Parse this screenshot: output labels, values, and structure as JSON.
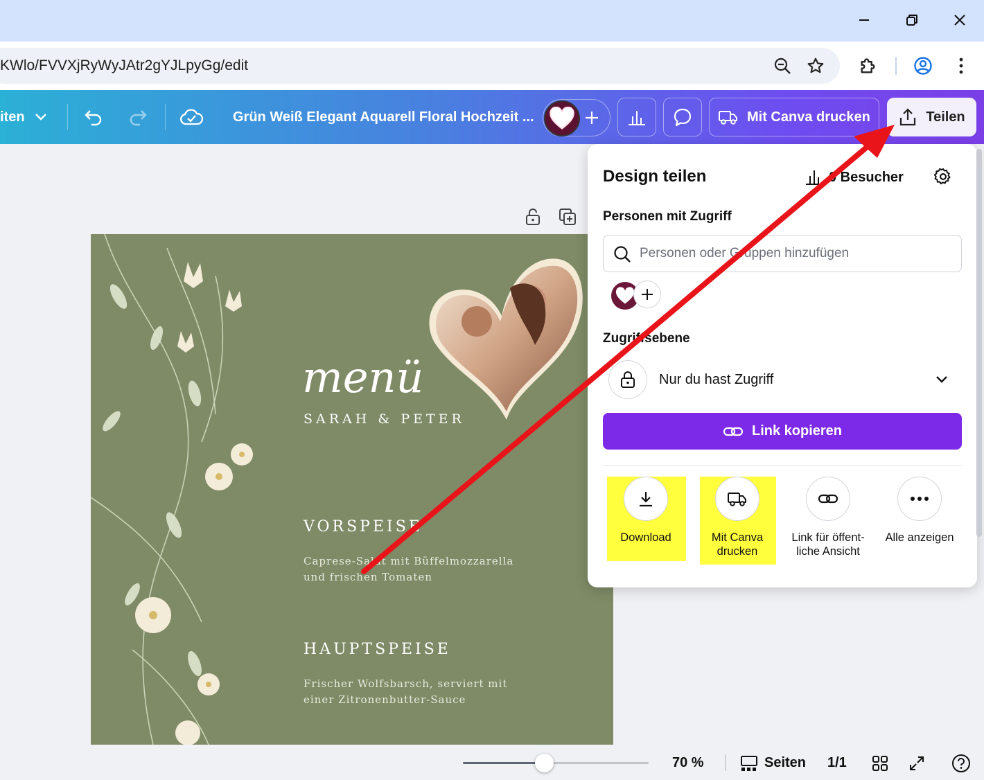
{
  "browser": {
    "url": "KWlo/FVVXjRyWyJAtr2gYJLpyGg/edit",
    "controls": {
      "minimize_icon": "minimize-icon",
      "restore_icon": "restore-icon",
      "close_icon": "close-icon"
    }
  },
  "toolbar": {
    "pages_menu_label": "iten",
    "doc_title": "Grün Weiß Elegant Aquarell Floral Hochzeit ...",
    "print_label": "Mit Canva drucken",
    "share_label": "Teilen"
  },
  "design": {
    "menu_title": "menü",
    "names": "SARAH & PETER",
    "sections": [
      {
        "heading": "VORSPEISE",
        "body_line1": "Caprese-Salat mit Büffelmozzarella",
        "body_line2": "und frischen Tomaten"
      },
      {
        "heading": "HAUPTSPEISE",
        "body_line1": "Frischer Wolfsbarsch, serviert mit",
        "body_line2": "einer Zitronenbutter-Sauce"
      }
    ]
  },
  "share_panel": {
    "title": "Design teilen",
    "visitors_label": "0 Besucher",
    "people_label": "Personen mit Zugriff",
    "search_placeholder": "Personen oder Gruppen hinzufügen",
    "access_level_label": "Zugriffsebene",
    "access_value": "Nur du hast Zugriff",
    "copy_link_label": "Link kopieren",
    "actions": [
      {
        "label_line1": "Download",
        "label_line2": "",
        "icon": "download-icon",
        "highlighted": true
      },
      {
        "label_line1": "Mit Canva",
        "label_line2": "drucken",
        "icon": "truck-icon",
        "highlighted": true
      },
      {
        "label_line1": "Link für öffent-",
        "label_line2": "liche Ansicht",
        "icon": "link-icon",
        "highlighted": false
      },
      {
        "label_line1": "Alle anzeigen",
        "label_line2": "",
        "icon": "more-icon",
        "highlighted": false
      }
    ]
  },
  "bottom_bar": {
    "zoom_percent": 70,
    "zoom_label": "70 %",
    "pages_label": "Seiten",
    "page_counter": "1/1"
  },
  "colors": {
    "highlight": "#ffff3d",
    "primary_button": "#7d2ae8",
    "canvas_green": "#7e8b66",
    "annotation_arrow": "#e8141a"
  }
}
